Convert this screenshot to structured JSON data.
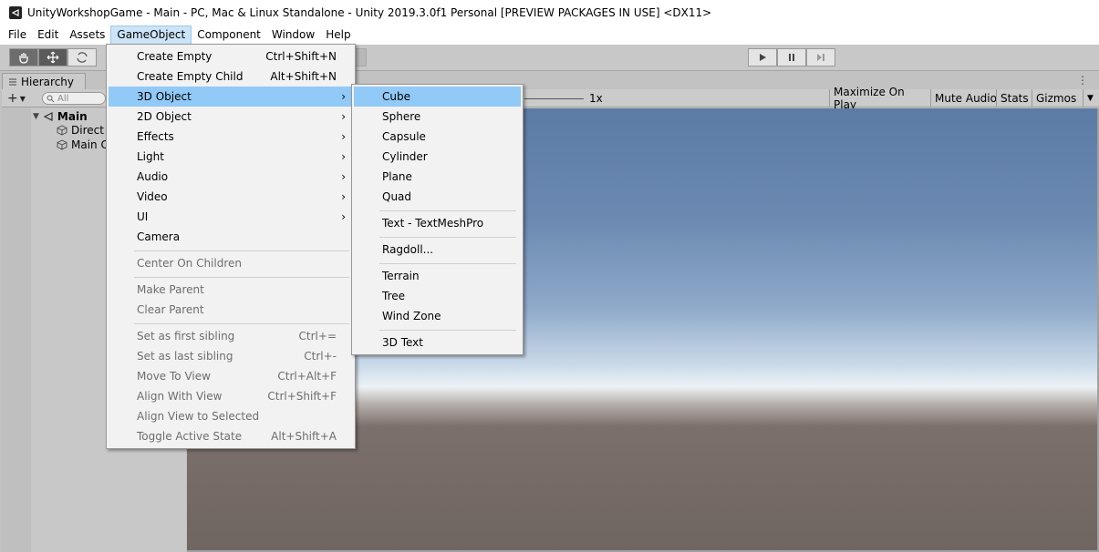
{
  "window": {
    "title": "UnityWorkshopGame - Main - PC, Mac & Linux Standalone - Unity 2019.3.0f1 Personal [PREVIEW PACKAGES IN USE] <DX11>",
    "icon": "unity-logo-icon"
  },
  "menubar": {
    "items": [
      "File",
      "Edit",
      "Assets",
      "GameObject",
      "Component",
      "Window",
      "Help"
    ],
    "active": "GameObject"
  },
  "toolbar": {
    "tools": [
      "hand-tool-icon",
      "move-tool-icon",
      "rotate-tool-icon"
    ],
    "play_controls": [
      "play-icon",
      "pause-icon",
      "step-icon"
    ]
  },
  "hierarchy": {
    "tab_label": "Hierarchy",
    "search_placeholder": "All",
    "scene": "Main",
    "items": [
      "Direct",
      "Main C"
    ]
  },
  "game_view": {
    "scale_value": "1x",
    "buttons": [
      "Maximize On Play",
      "Mute Audio",
      "Stats",
      "Gizmos"
    ]
  },
  "gameobject_menu": {
    "items": [
      {
        "label": "Create Empty",
        "shortcut": "Ctrl+Shift+N",
        "enabled": true
      },
      {
        "label": "Create Empty Child",
        "shortcut": "Alt+Shift+N",
        "enabled": true
      },
      {
        "label": "3D Object",
        "submenu": true,
        "enabled": true,
        "highlighted": true
      },
      {
        "label": "2D Object",
        "submenu": true,
        "enabled": true
      },
      {
        "label": "Effects",
        "submenu": true,
        "enabled": true
      },
      {
        "label": "Light",
        "submenu": true,
        "enabled": true
      },
      {
        "label": "Audio",
        "submenu": true,
        "enabled": true
      },
      {
        "label": "Video",
        "submenu": true,
        "enabled": true
      },
      {
        "label": "UI",
        "submenu": true,
        "enabled": true
      },
      {
        "label": "Camera",
        "enabled": true
      },
      {
        "label": "Center On Children",
        "enabled": false
      },
      {
        "label": "Make Parent",
        "enabled": false
      },
      {
        "label": "Clear Parent",
        "enabled": false
      },
      {
        "label": "Set as first sibling",
        "shortcut": "Ctrl+=",
        "enabled": false
      },
      {
        "label": "Set as last sibling",
        "shortcut": "Ctrl+-",
        "enabled": false
      },
      {
        "label": "Move To View",
        "shortcut": "Ctrl+Alt+F",
        "enabled": false
      },
      {
        "label": "Align With View",
        "shortcut": "Ctrl+Shift+F",
        "enabled": false
      },
      {
        "label": "Align View to Selected",
        "enabled": false
      },
      {
        "label": "Toggle Active State",
        "shortcut": "Alt+Shift+A",
        "enabled": false
      }
    ]
  },
  "object_3d_submenu": {
    "items": [
      "Cube",
      "Sphere",
      "Capsule",
      "Cylinder",
      "Plane",
      "Quad",
      "Text - TextMeshPro",
      "Ragdoll...",
      "Terrain",
      "Tree",
      "Wind Zone",
      "3D Text"
    ],
    "highlighted": "Cube"
  },
  "colors": {
    "menu_highlight": "#91c9f7",
    "menubar_active": "#cce4f7",
    "disabled_text": "#6d6d6d"
  }
}
